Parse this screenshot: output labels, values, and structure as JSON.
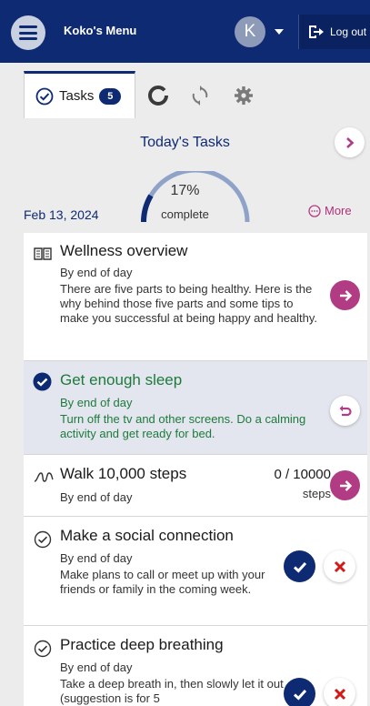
{
  "header": {
    "app_title": "Koko's Menu",
    "user_initial": "K",
    "logout_label": "Log out"
  },
  "tabs": {
    "tasks_label": "Tasks",
    "tasks_count": "5",
    "icons": [
      "check-circle-icon",
      "progress-ring-icon",
      "sync-icon",
      "gear-icon"
    ]
  },
  "summary": {
    "title": "Today's Tasks",
    "percent_text": "17%",
    "percent_value": 17,
    "complete_label": "complete",
    "date": "Feb 13, 2024",
    "more_label": "More"
  },
  "tasks": [
    {
      "title": "Wellness overview",
      "due": "By end of day",
      "desc": "There are five parts to being healthy. Here is the why behind those five parts and some tips to make you successful at being happy and healthy.",
      "icon": "book-icon",
      "status": "open"
    },
    {
      "title": "Get enough sleep",
      "due": "By end of day",
      "desc": "Turn off the tv and other screens. Do a calming activity and get ready for bed.",
      "icon": "checked-circle-icon",
      "status": "done"
    },
    {
      "title": "Walk 10,000 steps",
      "due": "By end of day",
      "steps_count": "0 / 10000",
      "steps_unit": "steps",
      "icon": "footprints-icon",
      "status": "open"
    },
    {
      "title": "Make a social connection",
      "due": "By end of day",
      "desc": "Make plans to call or meet up with your friends or family in the coming week.",
      "icon": "check-circle-outline-icon",
      "status": "open"
    },
    {
      "title": "Practice deep breathing",
      "due": "By end of day",
      "desc": "Take a deep breath in, then slowly let it out (suggestion is for 5",
      "icon": "check-circle-outline-icon",
      "status": "open"
    }
  ],
  "colors": {
    "navy": "#0d2a73",
    "pink": "#b23c84",
    "done_green": "#1e7a3c",
    "done_bg": "#e3e6ee",
    "red": "#d11a1a"
  }
}
